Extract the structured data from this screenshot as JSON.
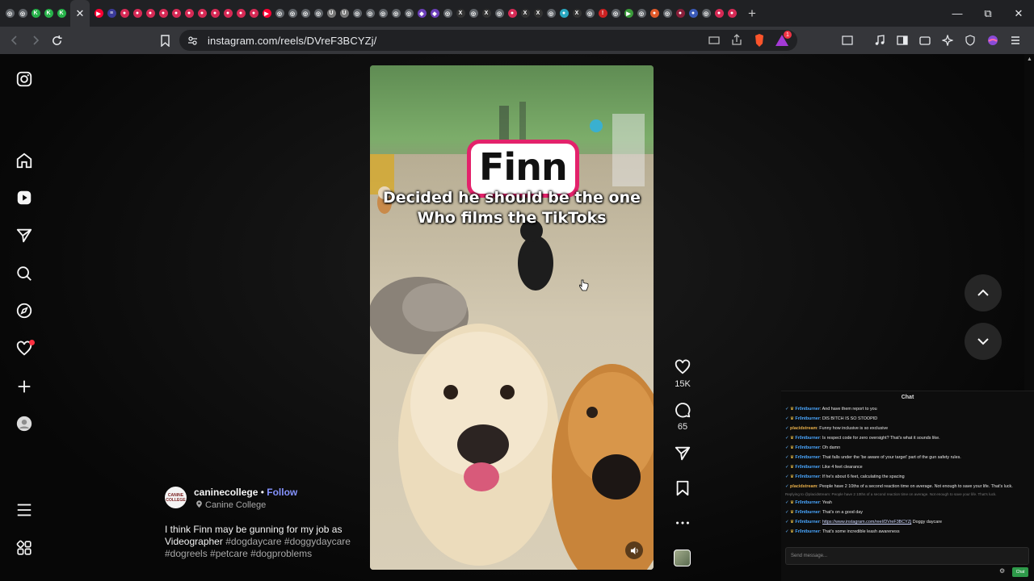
{
  "browser": {
    "url": "instagram.com/reels/DVreF3BCYZj/",
    "tabs": [
      {
        "color": "#5f6368",
        "glyph": "◎"
      },
      {
        "color": "#5f6368",
        "glyph": "◎"
      },
      {
        "color": "#27b24a",
        "glyph": "K"
      },
      {
        "color": "#27b24a",
        "glyph": "K"
      },
      {
        "color": "#27b24a",
        "glyph": "K"
      },
      {
        "color": "#ff0033",
        "glyph": "▶"
      },
      {
        "color": "#3a3a9a",
        "glyph": "≡"
      },
      {
        "color": "#d62a55",
        "glyph": "●"
      },
      {
        "color": "#d62a55",
        "glyph": "●"
      },
      {
        "color": "#d62a55",
        "glyph": "●"
      },
      {
        "color": "#d62a55",
        "glyph": "●"
      },
      {
        "color": "#d62a55",
        "glyph": "●"
      },
      {
        "color": "#d62a55",
        "glyph": "●"
      },
      {
        "color": "#d62a55",
        "glyph": "●"
      },
      {
        "color": "#d62a55",
        "glyph": "●"
      },
      {
        "color": "#d62a55",
        "glyph": "●"
      },
      {
        "color": "#d62a55",
        "glyph": "●"
      },
      {
        "color": "#d62a55",
        "glyph": "●"
      },
      {
        "color": "#ff0033",
        "glyph": "▶"
      },
      {
        "color": "#5f6368",
        "glyph": "◎"
      },
      {
        "color": "#5f6368",
        "glyph": "◎"
      },
      {
        "color": "#5f6368",
        "glyph": "◎"
      },
      {
        "color": "#5f6368",
        "glyph": "◎"
      },
      {
        "color": "#777",
        "glyph": "U"
      },
      {
        "color": "#777",
        "glyph": "U"
      },
      {
        "color": "#5f6368",
        "glyph": "◎"
      },
      {
        "color": "#5f6368",
        "glyph": "◎"
      },
      {
        "color": "#5f6368",
        "glyph": "◎"
      },
      {
        "color": "#5f6368",
        "glyph": "◎"
      },
      {
        "color": "#5f6368",
        "glyph": "◎"
      },
      {
        "color": "#6b3fb8",
        "glyph": "◆"
      },
      {
        "color": "#6b3fb8",
        "glyph": "◆"
      },
      {
        "color": "#5f6368",
        "glyph": "◎"
      },
      {
        "color": "#333",
        "glyph": "X"
      },
      {
        "color": "#5f6368",
        "glyph": "◎"
      },
      {
        "color": "#333",
        "glyph": "X"
      },
      {
        "color": "#5f6368",
        "glyph": "◎"
      },
      {
        "color": "#d62a55",
        "glyph": "●"
      },
      {
        "color": "#333",
        "glyph": "X"
      },
      {
        "color": "#333",
        "glyph": "X"
      },
      {
        "color": "#5f6368",
        "glyph": "◎"
      },
      {
        "color": "#2aa7c0",
        "glyph": "●"
      },
      {
        "color": "#333",
        "glyph": "X"
      },
      {
        "color": "#5f6368",
        "glyph": "◎"
      },
      {
        "color": "#c22",
        "glyph": "!"
      },
      {
        "color": "#5f6368",
        "glyph": "◎"
      },
      {
        "color": "#3a9a3a",
        "glyph": "▶"
      },
      {
        "color": "#5f6368",
        "glyph": "◎"
      },
      {
        "color": "#e05a2a",
        "glyph": "●"
      },
      {
        "color": "#5f6368",
        "glyph": "◎"
      },
      {
        "color": "#8a1f3a",
        "glyph": "●"
      },
      {
        "color": "#3a5ab8",
        "glyph": "●"
      },
      {
        "color": "#5f6368",
        "glyph": "◎"
      },
      {
        "color": "#d62a55",
        "glyph": "●"
      },
      {
        "color": "#d62a55",
        "glyph": "●"
      }
    ],
    "brave_badge": "1"
  },
  "reel": {
    "finn_title": "Finn",
    "caption_line1": "Decided he should be the one",
    "caption_line2": "Who films the TikToks",
    "likes": "15K",
    "comments": "65",
    "username": "caninecollege",
    "separator": "•",
    "follow_label": "Follow",
    "location": "Canine College",
    "avatar_text": "CANINE COLLEGE",
    "description": "I think Finn may be gunning for my job as Videographer",
    "hashtags": "#dogdaycare #doggydaycare #dogreels #petcare #dogproblems"
  },
  "chat": {
    "title": "Chat",
    "input_placeholder": "Send message...",
    "send_label": "Chat",
    "messages": [
      {
        "user": "Fr0ntburner",
        "text": ": And have them report to you",
        "kind": "fr"
      },
      {
        "user": "Fr0ntburner",
        "text": ": DIS BITCH IS SO STOOPID",
        "kind": "fr"
      },
      {
        "user": "placidstream",
        "text": ": Funny how inclusive is so exclusive",
        "kind": "pl"
      },
      {
        "user": "Fr0ntburner",
        "text": ": Is respect code for zero oversight? That's what it sounds like.",
        "kind": "fr"
      },
      {
        "user": "Fr0ntburner",
        "text": ": Oh damn",
        "kind": "fr"
      },
      {
        "user": "Fr0ntburner",
        "text": ": That falls under the 'be aware of your target' part of the gun safety rules.",
        "kind": "fr"
      },
      {
        "user": "Fr0ntburner",
        "text": ": Like 4 feet clearance",
        "kind": "fr"
      },
      {
        "user": "Fr0ntburner",
        "text": ": If he's about 6 feet, calculating the spacing",
        "kind": "fr"
      },
      {
        "user": "placidstream",
        "text": ": People have 2 10ths of a second reaction time on average. Not enough to save your life. That's luck.",
        "kind": "pl",
        "wrap": true
      },
      {
        "user": "",
        "text": "Replying to @placidstream: People have 2 10ths of a second reaction time on average. Not enough to save your life. That's luck.",
        "kind": "reply"
      },
      {
        "user": "Fr0ntburner",
        "text": ": Yeah",
        "kind": "fr"
      },
      {
        "user": "Fr0ntburner",
        "text": ": That's on a good day",
        "kind": "fr"
      },
      {
        "user": "Fr0ntburner",
        "text": ": ",
        "kind": "fr",
        "link": "https://www.instagram.com/reel/DVreF3BCYZj",
        "after": " Doggy daycare"
      },
      {
        "user": "Fr0ntburner",
        "text": ": That's some incredible leash awareness",
        "kind": "fr"
      }
    ]
  }
}
